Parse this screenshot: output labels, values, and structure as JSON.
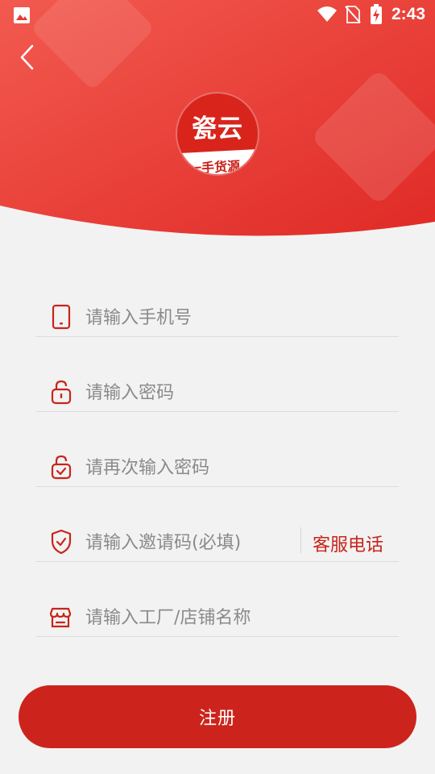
{
  "status_bar": {
    "time": "2:43",
    "icons": [
      "image-icon",
      "wifi-icon",
      "no-sim-icon",
      "battery-charging-icon"
    ]
  },
  "header": {
    "back_icon": "chevron-left-icon",
    "logo": {
      "main_text": "瓷云",
      "sub_text": "一手货源"
    }
  },
  "form": {
    "phone": {
      "placeholder": "请输入手机号",
      "icon": "phone-icon"
    },
    "password": {
      "placeholder": "请输入密码",
      "icon": "lock-icon"
    },
    "confirm_password": {
      "placeholder": "请再次输入密码",
      "icon": "lock-check-icon"
    },
    "invite_code": {
      "placeholder": "请输入邀请码(必填)",
      "icon": "shield-check-icon",
      "service_label": "客服电话"
    },
    "shop_name": {
      "placeholder": "请输入工厂/店铺名称",
      "icon": "store-icon"
    }
  },
  "register_button": {
    "label": "注册"
  },
  "colors": {
    "accent": "#cc241c",
    "header_red": "#e53935",
    "placeholder": "#8a8a8a"
  }
}
